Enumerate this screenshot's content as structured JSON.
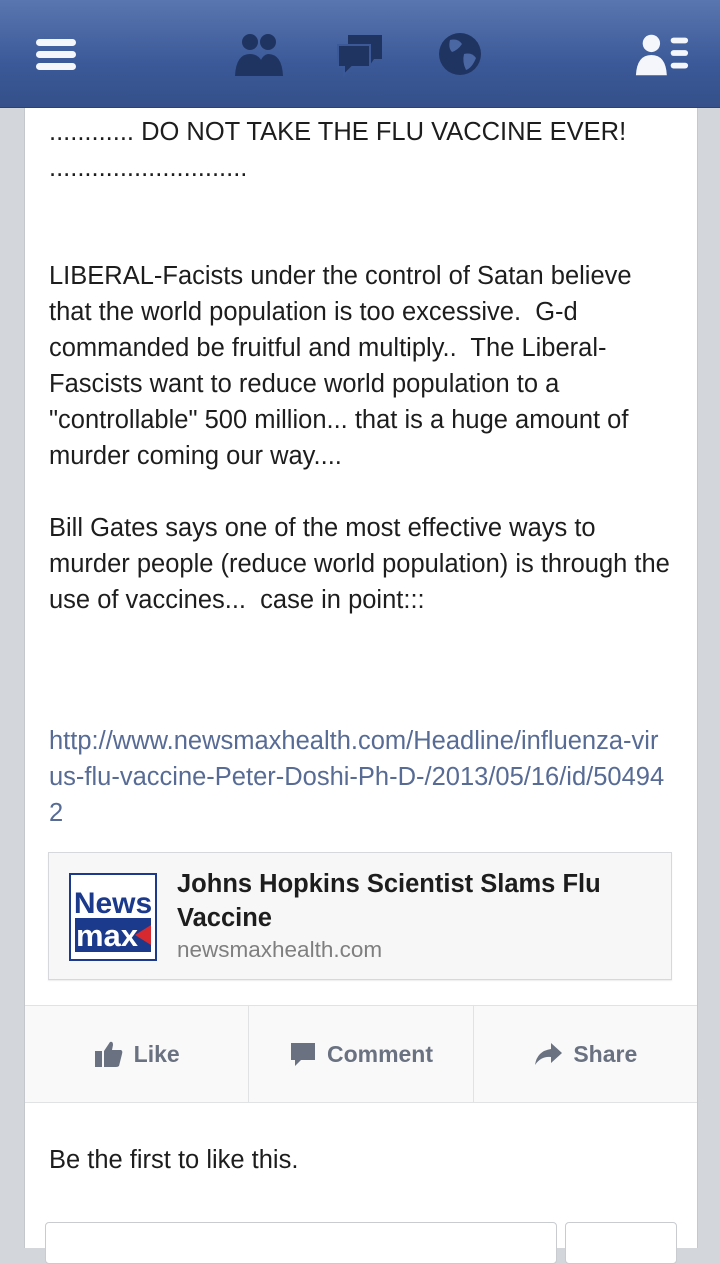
{
  "topbar": {
    "icons": [
      "menu-icon",
      "friends-icon",
      "messages-icon",
      "globe-icon",
      "friend-requests-icon"
    ],
    "colors": {
      "background": "#3b5998",
      "icon": "#f4f6fb"
    }
  },
  "post": {
    "text": "............ DO NOT TAKE THE FLU VACCINE EVER! ............................\n\n\nLIBERAL-Facists under the control of Satan believe that the world population is too excessive.  G-d commanded be fruitful and multiply..  The Liberal-Fascists want to reduce world population to a \"controllable\" 500 million... that is a huge amount of murder coming our way....\n\nBill Gates says one of the most effective ways to murder people (reduce world population) is through the use of vaccines...  case in point:::",
    "link": "http://www.newsmaxhealth.com/Headline/influenza-virus-flu-vaccine-Peter-Doshi-Ph-D-/2013/05/16/id/504942",
    "link_color": "#576b95"
  },
  "preview": {
    "logo_top": "News",
    "logo_bottom": "max",
    "title": "Johns Hopkins Scientist Slams Flu Vaccine",
    "domain": "newsmaxhealth.com"
  },
  "actions": {
    "like": "Like",
    "comment": "Comment",
    "share": "Share",
    "icons": [
      "thumbs-up-icon",
      "comment-bubble-icon",
      "share-arrow-icon"
    ]
  },
  "likes": {
    "text": "Be the first to like this."
  }
}
